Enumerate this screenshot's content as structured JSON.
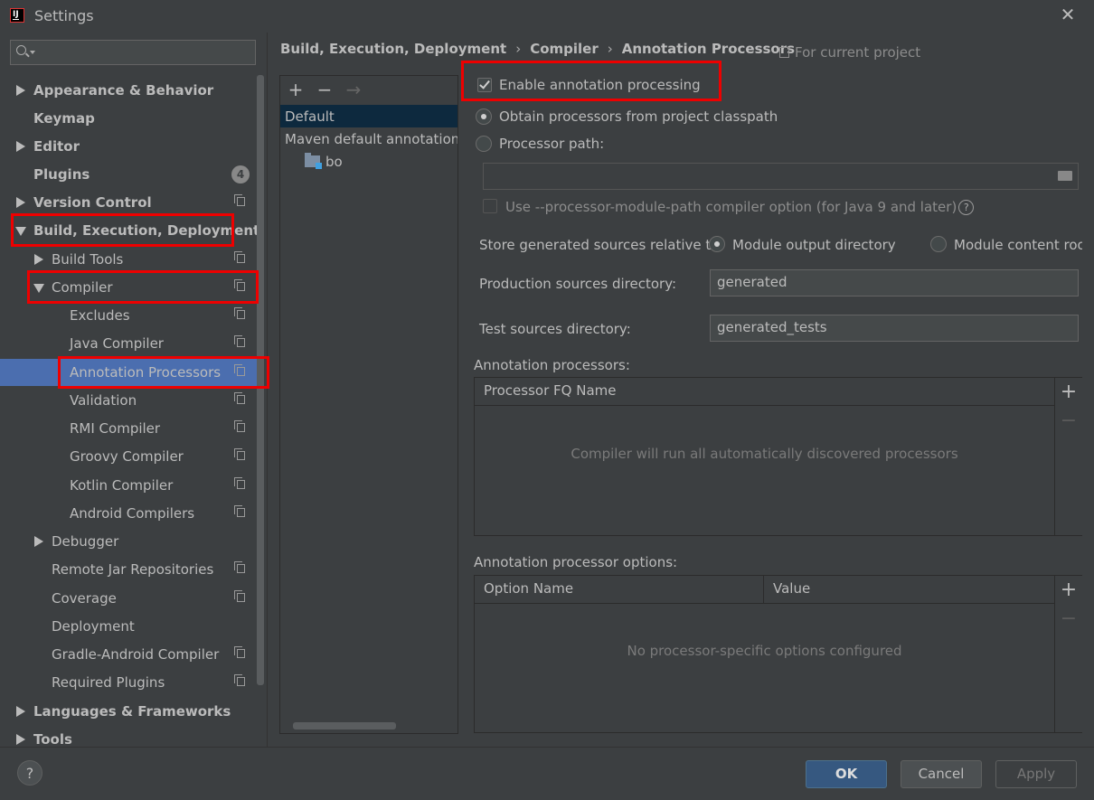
{
  "window": {
    "title": "Settings"
  },
  "search": {
    "placeholder": ""
  },
  "sidebar": {
    "items": [
      {
        "label": "Appearance & Behavior"
      },
      {
        "label": "Keymap"
      },
      {
        "label": "Editor"
      },
      {
        "label": "Plugins",
        "badge": "4"
      },
      {
        "label": "Version Control"
      },
      {
        "label": "Build, Execution, Deployment"
      },
      {
        "label": "Build Tools"
      },
      {
        "label": "Compiler"
      },
      {
        "label": "Excludes"
      },
      {
        "label": "Java Compiler"
      },
      {
        "label": "Annotation Processors"
      },
      {
        "label": "Validation"
      },
      {
        "label": "RMI Compiler"
      },
      {
        "label": "Groovy Compiler"
      },
      {
        "label": "Kotlin Compiler"
      },
      {
        "label": "Android Compilers"
      },
      {
        "label": "Debugger"
      },
      {
        "label": "Remote Jar Repositories"
      },
      {
        "label": "Coverage"
      },
      {
        "label": "Deployment"
      },
      {
        "label": "Gradle-Android Compiler"
      },
      {
        "label": "Required Plugins"
      },
      {
        "label": "Languages & Frameworks"
      },
      {
        "label": "Tools"
      }
    ]
  },
  "breadcrumb": {
    "items": [
      "Build, Execution, Deployment",
      "Compiler",
      "Annotation Processors"
    ],
    "separator": "›",
    "scope": "For current project"
  },
  "profiles": {
    "toolbar": {
      "add": "+",
      "remove": "−",
      "move": "→"
    },
    "items": [
      {
        "label": "Default"
      },
      {
        "label": "Maven default annotation p"
      },
      {
        "label": "bo"
      }
    ]
  },
  "settings": {
    "enable_label": "Enable annotation processing",
    "enable_checked": true,
    "obtain_label": "Obtain processors from project classpath",
    "processor_path_label": "Processor path:",
    "processor_path_value": "",
    "module_path_label": "Use --processor-module-path compiler option (for Java 9 and later)",
    "store_label": "Store generated sources relative to:",
    "module_output_label": "Module output directory",
    "module_content_label": "Module content root",
    "prod_label": "Production sources directory:",
    "prod_value": "generated",
    "test_label": "Test sources directory:",
    "test_value": "generated_tests"
  },
  "processors_table": {
    "title": "Annotation processors:",
    "column": "Processor FQ Name",
    "empty": "Compiler will run all automatically discovered processors"
  },
  "options_table": {
    "title": "Annotation processor options:",
    "columns": [
      "Option Name",
      "Value"
    ],
    "empty": "No processor-specific options configured"
  },
  "footer": {
    "help": "?",
    "ok": "OK",
    "cancel": "Cancel",
    "apply": "Apply"
  },
  "colors": {
    "selection": "#4b6eaf",
    "highlight": "#e00000",
    "primary": "#365880"
  }
}
